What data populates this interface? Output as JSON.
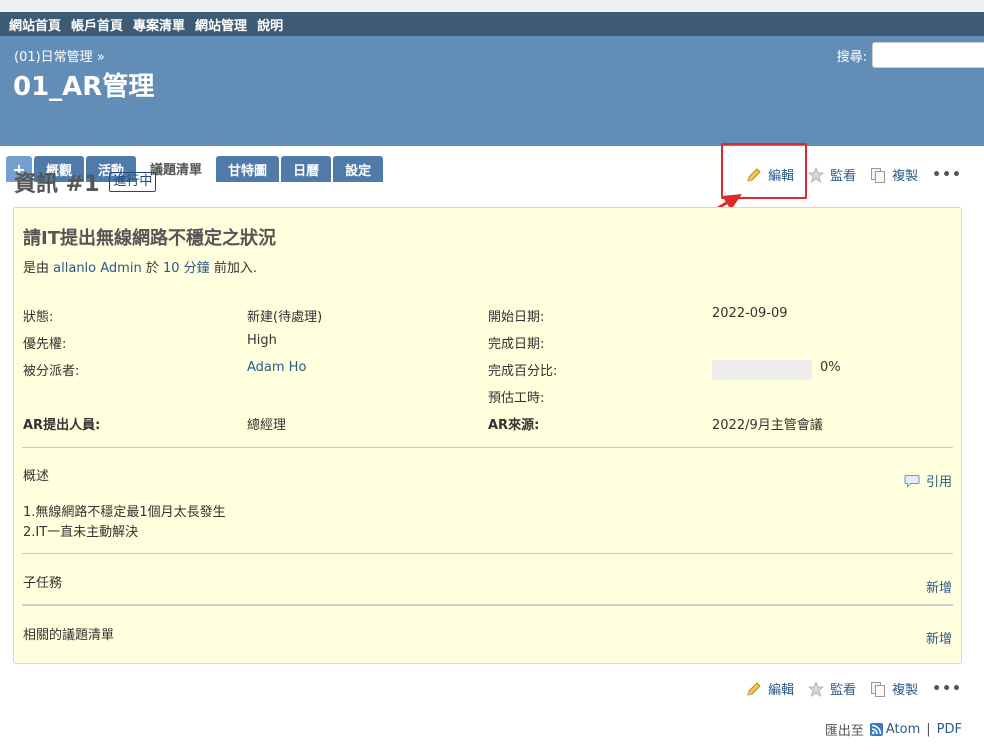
{
  "top_menu": {
    "items": [
      {
        "label": "網站首頁"
      },
      {
        "label": "帳戶首頁"
      },
      {
        "label": "專案清單"
      },
      {
        "label": "網站管理"
      },
      {
        "label": "說明"
      }
    ]
  },
  "header": {
    "breadcrumb": "(01)日常管理 »",
    "title": "01_AR管理",
    "search_label": "搜尋:"
  },
  "main_menu": {
    "tabs": [
      {
        "label": "+"
      },
      {
        "label": "概觀"
      },
      {
        "label": "活動"
      },
      {
        "label": "議題清單",
        "selected": true
      },
      {
        "label": "甘特圖"
      },
      {
        "label": "日曆"
      },
      {
        "label": "設定"
      }
    ]
  },
  "issue": {
    "heading": "資訊 #1",
    "status_badge": "進行中",
    "actions": {
      "edit": "編輯",
      "watch": "監看",
      "copy": "複製",
      "more": "•••"
    },
    "subject": "請IT提出無線網路不穩定之狀況",
    "author": {
      "prefix": "是由",
      "name": "allanlo Admin",
      "mid": "於",
      "time": "10 分鐘",
      "suffix": "前加入."
    },
    "attributes": {
      "status_label": "狀態:",
      "status_value": "新建(待處理)",
      "priority_label": "優先權:",
      "priority_value": "High",
      "assignee_label": "被分派者:",
      "assignee_value": "Adam Ho",
      "start_label": "開始日期:",
      "start_value": "2022-09-09",
      "due_label": "完成日期:",
      "done_label": "完成百分比:",
      "done_value": "0%",
      "done_ratio": 0,
      "estimate_label": "預估工時:",
      "ar_person_label": "AR提出人員:",
      "ar_person_value": "總經理",
      "ar_source_label": "AR來源:",
      "ar_source_value": "2022/9月主管會議"
    },
    "description": {
      "title": "概述",
      "quote": "引用",
      "lines": [
        "1.無線網路不穩定最1個月太長發生",
        "2.IT一直未主動解決"
      ]
    },
    "subtasks": {
      "title": "子任務",
      "add": "新增"
    },
    "relations": {
      "title": "相關的議題清單",
      "add": "新增"
    }
  },
  "export": {
    "label": "匯出至",
    "atom": "Atom",
    "pdf": "PDF"
  },
  "colors": {
    "header": "#628db6",
    "top_menu": "#3e5b76",
    "issue_bg": "#ffffdd",
    "highlight": "#e02a2a"
  }
}
